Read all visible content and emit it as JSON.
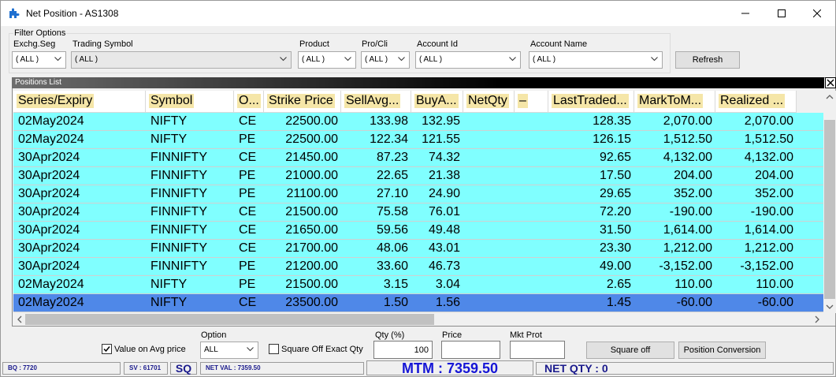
{
  "window": {
    "title": "Net Position - AS1308"
  },
  "filters": {
    "group_label": "Filter Options",
    "exchg_seg": {
      "label": "Exchg.Seg",
      "value": "( ALL )"
    },
    "trading_symbol": {
      "label": "Trading Symbol",
      "value": "( ALL )"
    },
    "product": {
      "label": "Product",
      "value": "( ALL )"
    },
    "pro_cli": {
      "label": "Pro/Cli",
      "value": "( ALL )"
    },
    "account_id": {
      "label": "Account Id",
      "value": "( ALL )"
    },
    "account_name": {
      "label": "Account Name",
      "value": "( ALL )"
    },
    "refresh_label": "Refresh"
  },
  "positions": {
    "title": "Positions List",
    "columns": [
      "Series/Expiry",
      "Symbol",
      "O...",
      "Strike Price",
      "SellAvg...",
      "BuyA...",
      "NetQty",
      "–",
      "LastTraded...",
      "MarkToM...",
      "Realized ..."
    ],
    "rows": [
      [
        "02May2024",
        "NIFTY",
        "CE",
        "22500.00",
        "133.98",
        "132.95",
        "",
        "",
        "128.35",
        "2,070.00",
        "2,070.00"
      ],
      [
        "02May2024",
        "NIFTY",
        "PE",
        "22500.00",
        "122.34",
        "121.55",
        "",
        "",
        "126.15",
        "1,512.50",
        "1,512.50"
      ],
      [
        "30Apr2024",
        "FINNIFTY",
        "CE",
        "21450.00",
        "87.23",
        "74.32",
        "",
        "",
        "92.65",
        "4,132.00",
        "4,132.00"
      ],
      [
        "30Apr2024",
        "FINNIFTY",
        "PE",
        "21000.00",
        "22.65",
        "21.38",
        "",
        "",
        "17.50",
        "204.00",
        "204.00"
      ],
      [
        "30Apr2024",
        "FINNIFTY",
        "PE",
        "21100.00",
        "27.10",
        "24.90",
        "",
        "",
        "29.65",
        "352.00",
        "352.00"
      ],
      [
        "30Apr2024",
        "FINNIFTY",
        "CE",
        "21500.00",
        "75.58",
        "76.01",
        "",
        "",
        "72.20",
        "-190.00",
        "-190.00"
      ],
      [
        "30Apr2024",
        "FINNIFTY",
        "CE",
        "21650.00",
        "59.56",
        "49.48",
        "",
        "",
        "31.50",
        "1,614.00",
        "1,614.00"
      ],
      [
        "30Apr2024",
        "FINNIFTY",
        "CE",
        "21700.00",
        "48.06",
        "43.01",
        "",
        "",
        "23.30",
        "1,212.00",
        "1,212.00"
      ],
      [
        "30Apr2024",
        "FINNIFTY",
        "PE",
        "21200.00",
        "33.60",
        "46.73",
        "",
        "",
        "49.00",
        "-3,152.00",
        "-3,152.00"
      ],
      [
        "02May2024",
        "NIFTY",
        "PE",
        "21500.00",
        "3.15",
        "3.04",
        "",
        "",
        "2.65",
        "110.00",
        "110.00"
      ],
      [
        "02May2024",
        "NIFTY",
        "CE",
        "23500.00",
        "1.50",
        "1.56",
        "",
        "",
        "1.45",
        "-60.00",
        "-60.00"
      ]
    ],
    "selected_row": 10
  },
  "controls": {
    "value_on_avg_label": "Value on Avg  price",
    "value_on_avg_checked": true,
    "option_label": "Option",
    "option_value": "ALL",
    "square_off_exact_label": "Square Off Exact Qty",
    "square_off_exact_checked": false,
    "qty_label": "Qty (%)",
    "qty_value": "100",
    "price_label": "Price",
    "price_value": "",
    "mkt_prot_label": "Mkt Prot",
    "mkt_prot_value": "",
    "square_off_label": "Square off",
    "position_conversion_label": "Position Conversion"
  },
  "status": {
    "bq": "BQ : 7720",
    "sv": "SV : 61701",
    "sq": "SQ",
    "net_val": "NET VAL : 7359.50",
    "mtm": "MTM : 7359.50",
    "net_qty": "NET QTY : 0"
  },
  "colors": {
    "row_bg": "#80ffff",
    "selected_row_bg": "#4f88e8",
    "header_highlight": "#f5e6a8",
    "status_text": "#1616d6"
  }
}
